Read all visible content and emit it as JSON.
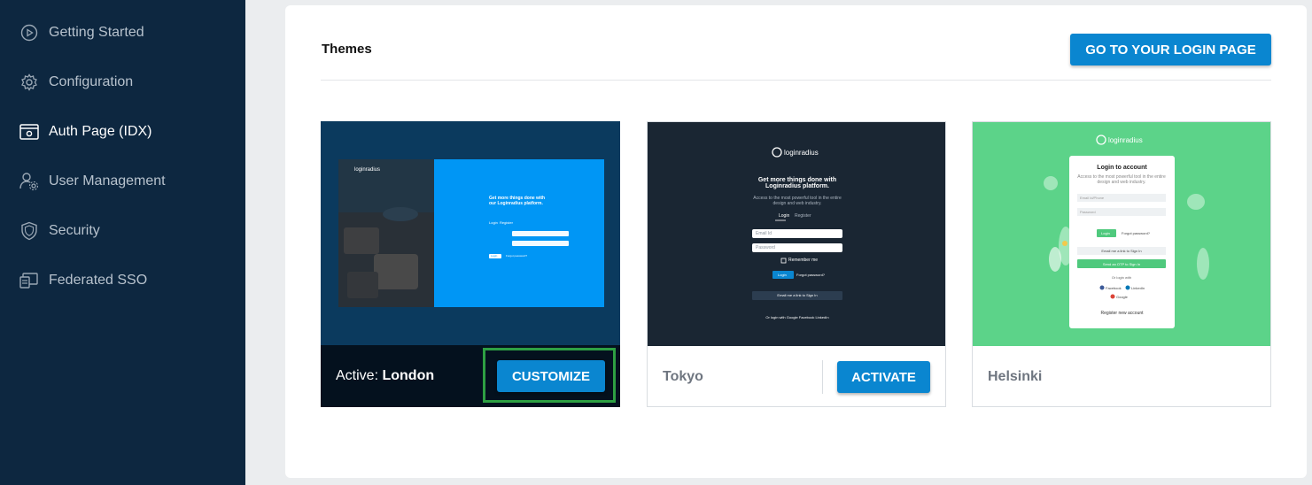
{
  "sidebar": {
    "items": [
      {
        "label": "Getting Started",
        "icon": "play-circle-icon"
      },
      {
        "label": "Configuration",
        "icon": "gear-icon"
      },
      {
        "label": "Auth Page (IDX)",
        "icon": "browser-settings-icon",
        "active": true
      },
      {
        "label": "User Management",
        "icon": "user-settings-icon"
      },
      {
        "label": "Security",
        "icon": "shield-icon"
      },
      {
        "label": "Federated SSO",
        "icon": "sso-icon"
      }
    ]
  },
  "main": {
    "title": "Themes",
    "login_page_button": "GO TO YOUR LOGIN PAGE",
    "themes": [
      {
        "prefix": "Active:",
        "name": "London",
        "button": "CUSTOMIZE",
        "active": true
      },
      {
        "name": "Tokyo",
        "button": "ACTIVATE"
      },
      {
        "name": "Helsinki"
      }
    ]
  },
  "previews": {
    "london": {
      "logo": "loginradius",
      "heading": "Get more things done with our Loginradius platform.",
      "tabs": [
        "Login",
        "Register"
      ],
      "button": "Login",
      "forgot": "Forgot password?"
    },
    "tokyo": {
      "logo": "loginradius",
      "heading": "Get more things done with Loginradius platform.",
      "sub": "Access to the most powerful tool in the entire design and web industry.",
      "tabs": [
        "Login",
        "Register"
      ],
      "email": "Email Id",
      "password": "Password",
      "remember": "Remember me",
      "button": "Login",
      "forgot": "Forgot password?",
      "email_link": "Email me a link to Sign In",
      "social": "Or login with    Google   Facebook   LinkedIn"
    },
    "helsinki": {
      "logo": "loginradius",
      "heading": "Login to account",
      "sub": "Access to the most powerful tool in the entire design and web industry.",
      "email": "Email Id/Phone",
      "password": "Password",
      "button": "Login",
      "forgot": "Forgot password?",
      "email_link": "Email me a link to Sign In",
      "otp": "Send an OTP to Sign In",
      "or": "Or login with",
      "social": [
        "Facebook",
        "LinkedIn",
        "Google"
      ],
      "register": "Register new account"
    }
  },
  "colors": {
    "sidebar_bg": "#0d2740",
    "accent": "#0a86d0",
    "highlight": "#2ea043"
  }
}
